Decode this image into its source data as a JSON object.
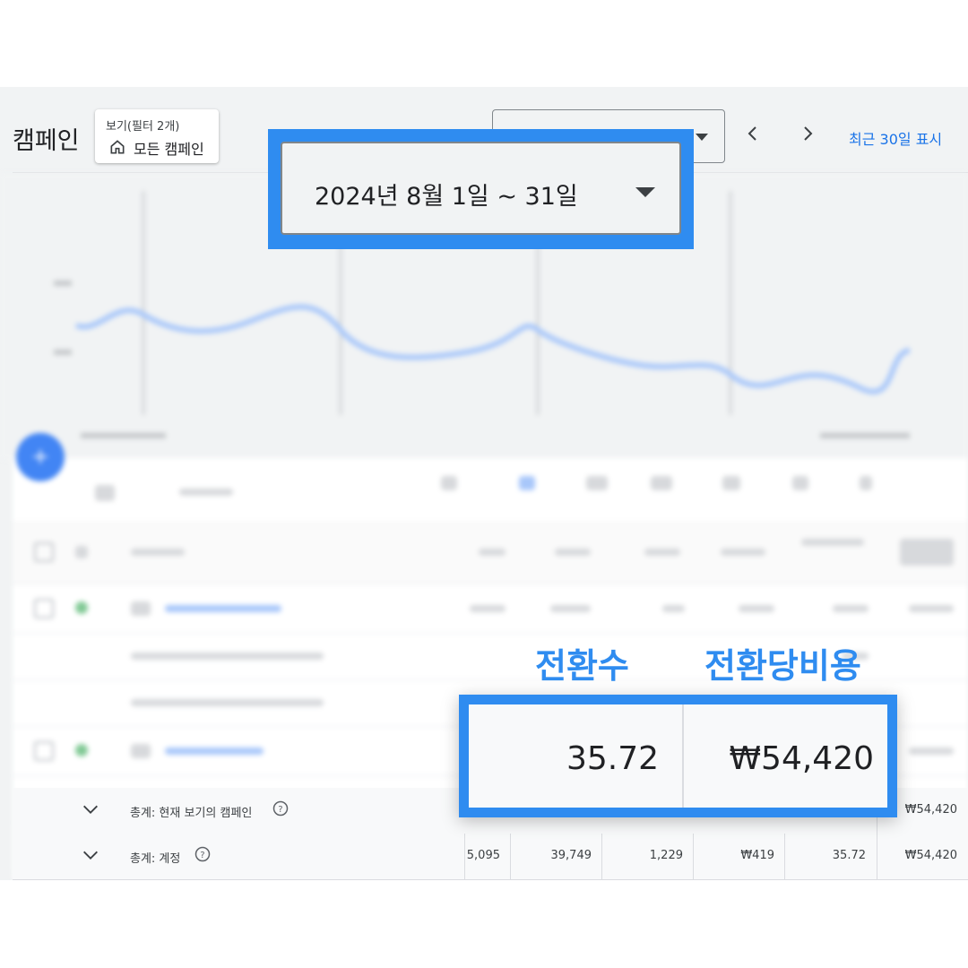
{
  "header": {
    "title": "캠페인",
    "view_label": "보기(필터 2개)",
    "view_value": "모든 캠페인",
    "recent_link": "최근 30일 표시"
  },
  "date_range": {
    "label": "2024년 8월 1일 ~ 31일"
  },
  "callout": {
    "conversions_label": "전환수",
    "cost_per_conversion_label": "전환당비용",
    "conversions_value": "35.72",
    "cost_per_conversion_value": "₩54,420"
  },
  "totals": {
    "view_total": {
      "label": "총계: 현재 보기의 캠페인",
      "cost_per_conversion": "₩54,420"
    },
    "account_total": {
      "label": "총계: 계정",
      "values": [
        "5,095",
        "39,749",
        "1,229",
        "₩419",
        "35.72",
        "₩54,420"
      ]
    }
  },
  "colors": {
    "accent": "#2f8cf0",
    "link": "#1a73e8",
    "fab": "#4285f4"
  }
}
